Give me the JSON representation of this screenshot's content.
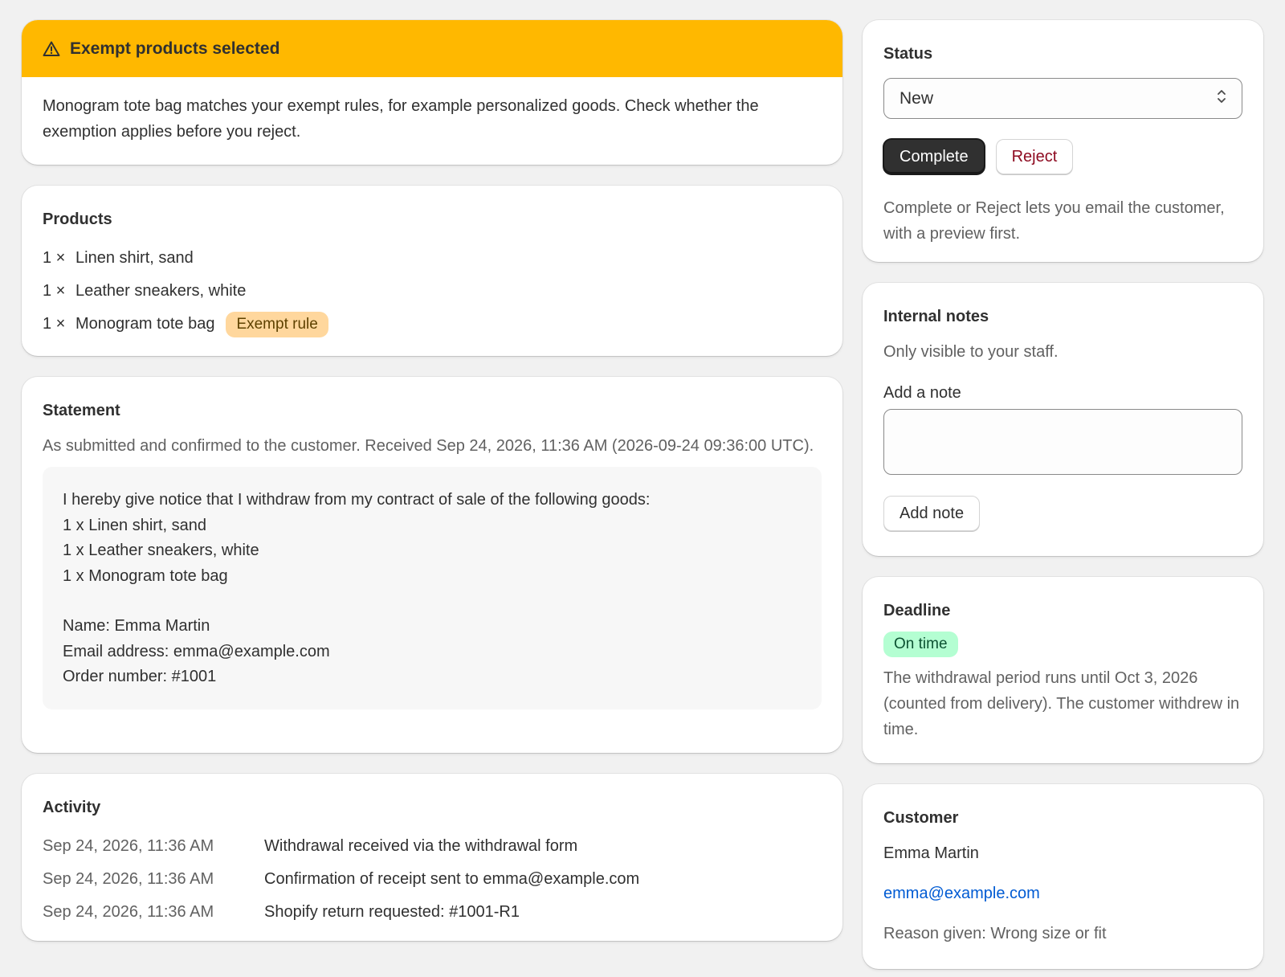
{
  "banner": {
    "title": "Exempt products selected",
    "message": "Monogram tote bag matches your exempt rules, for example personalized goods. Check whether the exemption applies before you reject."
  },
  "products": {
    "title": "Products",
    "items": [
      {
        "qty": "1 ×",
        "name": "Linen shirt, sand",
        "badge": ""
      },
      {
        "qty": "1 ×",
        "name": "Leather sneakers, white",
        "badge": ""
      },
      {
        "qty": "1 ×",
        "name": "Monogram tote bag",
        "badge": "Exempt rule"
      }
    ]
  },
  "statement": {
    "title": "Statement",
    "intro": "As submitted and confirmed to the customer. Received Sep 24, 2026, 11:36 AM (2026-09-24 09:36:00 UTC).",
    "lines": [
      "I hereby give notice that I withdraw from my contract of sale of the following goods:",
      "1 x Linen shirt, sand",
      "1 x Leather sneakers, white",
      "1 x Monogram tote bag"
    ],
    "details": [
      "Name: Emma Martin",
      "Email address: emma@example.com",
      "Order number: #1001"
    ]
  },
  "activity": {
    "title": "Activity",
    "rows": [
      {
        "time": "Sep 24, 2026, 11:36 AM",
        "event": "Withdrawal received via the withdrawal form"
      },
      {
        "time": "Sep 24, 2026, 11:36 AM",
        "event": "Confirmation of receipt sent to emma@example.com"
      },
      {
        "time": "Sep 24, 2026, 11:36 AM",
        "event": "Shopify return requested: #1001-R1"
      }
    ]
  },
  "status": {
    "title": "Status",
    "selected": "New",
    "complete_label": "Complete",
    "reject_label": "Reject",
    "help": "Complete or Reject lets you email the customer, with a preview first."
  },
  "notes": {
    "title": "Internal notes",
    "subtitle": "Only visible to your staff.",
    "field_label": "Add a note",
    "field_value": "",
    "button_label": "Add note"
  },
  "deadline": {
    "title": "Deadline",
    "badge": "On time",
    "text": "The withdrawal period runs until Oct 3, 2026 (counted from delivery). The customer withdrew in time."
  },
  "customer": {
    "title": "Customer",
    "name": "Emma Martin",
    "email": "emma@example.com",
    "reason": "Reason given: Wrong size or fit"
  },
  "colors": {
    "banner": "#ffb800",
    "exempt_badge": "#ffd79d",
    "ok_badge": "#b4fed2",
    "link": "#005bd3",
    "reject": "#8e0b21"
  },
  "icons": {
    "banner": "warning-triangle-icon",
    "select": "chevron-up-down-icon"
  }
}
